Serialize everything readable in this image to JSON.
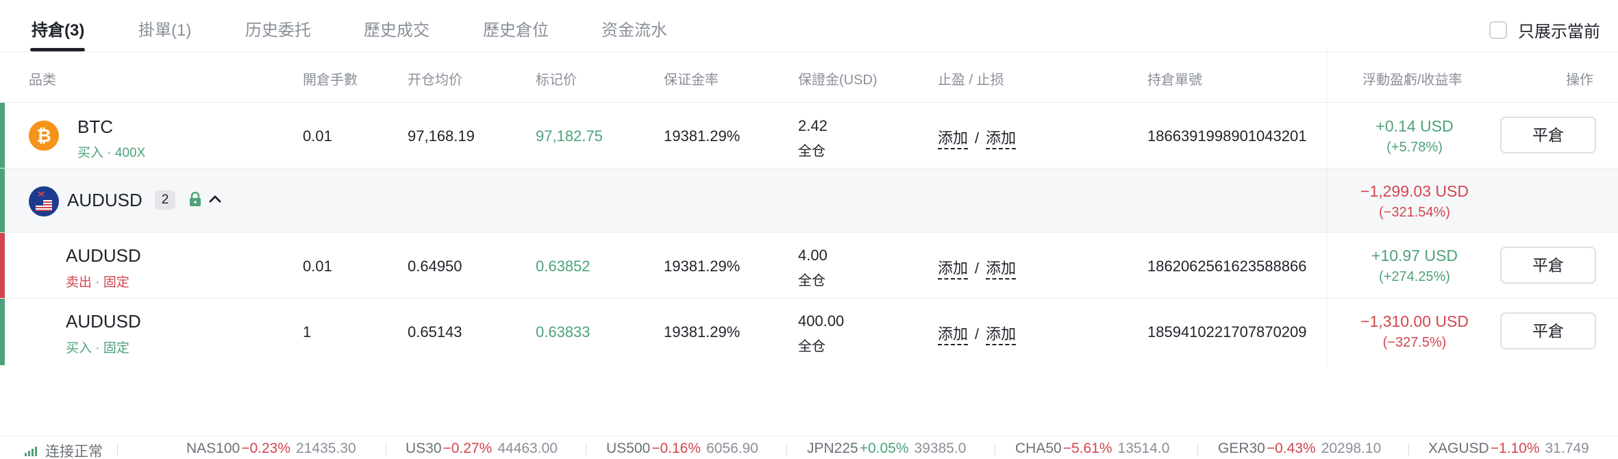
{
  "tabs": [
    {
      "label": "持倉(3)",
      "active": true
    },
    {
      "label": "掛單(1)",
      "active": false
    },
    {
      "label": "历史委托",
      "active": false
    },
    {
      "label": "歷史成交",
      "active": false
    },
    {
      "label": "歷史倉位",
      "active": false
    },
    {
      "label": "资金流水",
      "active": false
    }
  ],
  "only_current_label": "只展示當前",
  "only_current_checked": false,
  "columns": {
    "symbol": "品类",
    "lots": "開倉手數",
    "avg_price": "开仓均价",
    "mark_price": "标记价",
    "margin_rate": "保证金率",
    "margin": "保證金(USD)",
    "tp_sl": "止盈 / 止损",
    "order_id": "持倉單號",
    "pnl": "浮動盈虧/收益率",
    "action": "操作"
  },
  "positions": [
    {
      "symbol": "BTC",
      "side": "买入 · 400X",
      "side_color": "green",
      "lots": "0.01",
      "avg_price": "97,168.19",
      "mark_price": "97,182.75",
      "margin_rate": "19381.29%",
      "margin": "2.42",
      "margin_mode": "全仓",
      "tp": "添加",
      "sl": "添加",
      "order_id": "1866391998901043201",
      "pnl": "+0.14 USD",
      "pnl_rate": "(+5.78%)",
      "pnl_color": "green",
      "close_label": "平倉",
      "icon": "bitcoin-icon"
    },
    {
      "symbol": "AUDUSD",
      "side": "卖出 · 固定",
      "side_color": "red",
      "lots": "0.01",
      "avg_price": "0.64950",
      "mark_price": "0.63852",
      "margin_rate": "19381.29%",
      "margin": "4.00",
      "margin_mode": "全仓",
      "tp": "添加",
      "sl": "添加",
      "order_id": "1862062561623588866",
      "pnl": "+10.97 USD",
      "pnl_rate": "(+274.25%)",
      "pnl_color": "green",
      "close_label": "平倉"
    },
    {
      "symbol": "AUDUSD",
      "side": "买入 · 固定",
      "side_color": "green",
      "lots": "1",
      "avg_price": "0.65143",
      "mark_price": "0.63833",
      "margin_rate": "19381.29%",
      "margin": "400.00",
      "margin_mode": "全仓",
      "tp": "添加",
      "sl": "添加",
      "order_id": "1859410221707870209",
      "pnl": "−1,310.00 USD",
      "pnl_rate": "(−327.5%)",
      "pnl_color": "red",
      "close_label": "平倉"
    }
  ],
  "group": {
    "symbol": "AUDUSD",
    "count": "2",
    "pnl": "−1,299.03 USD",
    "pnl_rate": "(−321.54%)",
    "icons": [
      "aud-usd-flag-icon",
      "lock-icon",
      "chevron-up-icon"
    ]
  },
  "status": {
    "connection": "连接正常",
    "icon": "signal-bars-icon"
  },
  "ticker": [
    {
      "name": "NAS100",
      "change": "−0.23%",
      "price": "21435.30",
      "dir": "down"
    },
    {
      "name": "US30",
      "change": "−0.27%",
      "price": "44463.00",
      "dir": "down"
    },
    {
      "name": "US500",
      "change": "−0.16%",
      "price": "6056.90",
      "dir": "down"
    },
    {
      "name": "JPN225",
      "change": "+0.05%",
      "price": "39385.0",
      "dir": "up"
    },
    {
      "name": "CHA50",
      "change": "−5.61%",
      "price": "13514.0",
      "dir": "down"
    },
    {
      "name": "GER30",
      "change": "−0.43%",
      "price": "20298.10",
      "dir": "down"
    },
    {
      "name": "XAGUSD",
      "change": "−1.10%",
      "price": "31.749",
      "dir": "down"
    }
  ],
  "colors": {
    "up": "#4ea27a",
    "down": "#d2454e",
    "text": "#1f2329",
    "muted": "#8a8f99",
    "bitcoin": "#f7931a"
  }
}
